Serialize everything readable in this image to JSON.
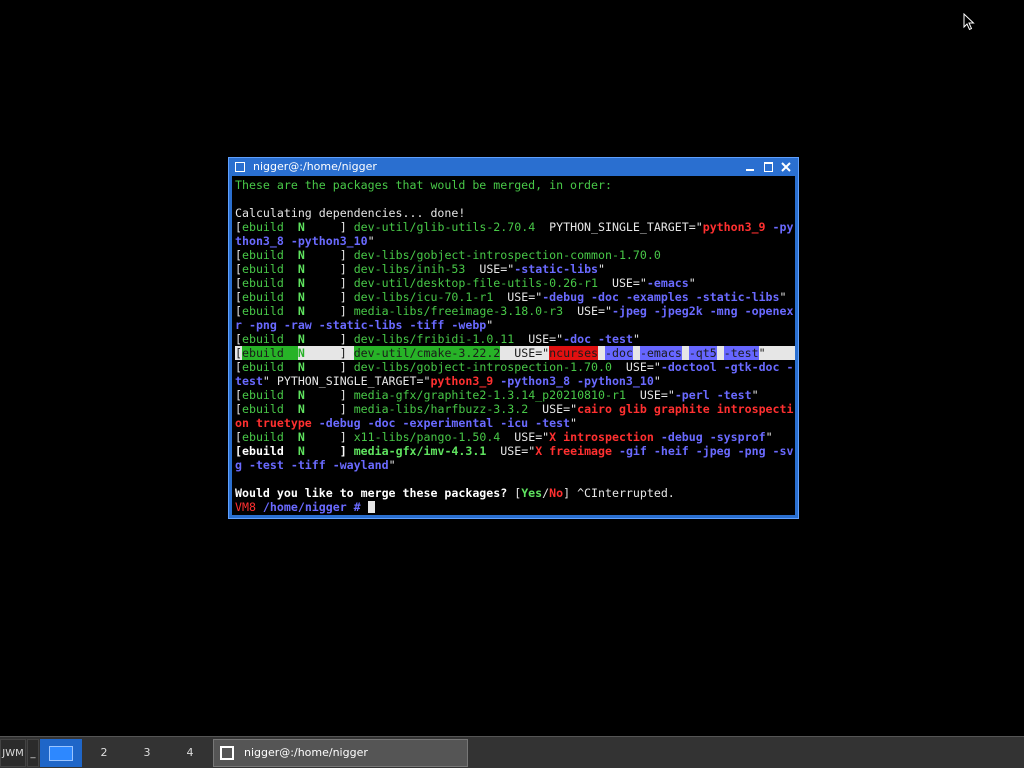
{
  "window": {
    "title": "nigger@:/home/nigger"
  },
  "terminal": {
    "l01": "These are the packages that would be merged, in order:",
    "l03": "Calculating dependencies... done!",
    "eb_open": "[",
    "eb_word": "ebuild",
    "eb_flag": "N",
    "eb_close": "]",
    "l04_pkg": "dev-util/glib-utils-2.70.4",
    "l04_mid": "  PYTHON_SINGLE_TARGET=\"",
    "l04_v1": "python3_9",
    "l04_v2": " -py",
    "l05_a": "thon3_8 -python3_10",
    "l05_q": "\"",
    "l06_pkg": "dev-libs/gobject-introspection-common-1.70.0",
    "l07_pkg": "dev-libs/inih-53",
    "use_open": "  USE=\"",
    "quote": "\"",
    "l07_u": "-static-libs",
    "l08_pkg": "dev-util/desktop-file-utils-0.26-r1",
    "l08_u": "-emacs",
    "l09_pkg": "dev-libs/icu-70.1-r1",
    "l09_u": "-debug -doc -examples -static-libs",
    "l10_pkg": "media-libs/freeimage-3.18.0-r3",
    "l10_u": "-jpeg -jpeg2k -mng -openex",
    "l11_u": "r -png -raw -static-libs -tiff -webp",
    "l12_pkg": "dev-libs/fribidi-1.0.11",
    "l12_u": "-doc -test",
    "l13_pkg": "dev-util/cmake-3.22.2",
    "l13_u1": "ncurses",
    "l13_u2": "-doc",
    "l13_u3": "-emacs",
    "l13_u4": "-qt5",
    "l13_u5": "-test",
    "l14_pkg": "dev-libs/gobject-introspection-1.70.0",
    "l14_u": "-doctool -gtk-doc -",
    "l15_a": "test",
    "l15_b": "\" PYTHON_SINGLE_TARGET=\"",
    "l15_c": "python3_9",
    "l15_d": " -python3_8 -python3_10",
    "l16_pkg": "media-gfx/graphite2-1.3.14_p20210810-r1",
    "l16_u": "-perl -test",
    "l17_pkg": "media-libs/harfbuzz-3.3.2",
    "l17_u": "cairo glib graphite introspecti",
    "l18_a": "on truetype",
    "l18_b": " -debug -doc -experimental -icu -test",
    "l19_pkg": "x11-libs/pango-1.50.4",
    "l19_u1": "X introspection",
    "l19_u2": " -debug -sysprof",
    "l20_pkg": "media-gfx/imv-4.3.1",
    "l20_u1": "X freeimage",
    "l20_u2": " -gif -heif -jpeg -png -sv",
    "l21_a": "g -test -tiff -wayland",
    "l23_q": "Would you like to merge these packages?",
    "l23_b1": " [",
    "l23_yes": "Yes",
    "l23_slash": "/",
    "l23_no": "No",
    "l23_b2": "] ^CInterrupted.",
    "prompt_host": "VM8",
    "prompt_path": " /home/nigger #",
    "prompt_space": " "
  },
  "taskbar": {
    "menu_label": "JWM",
    "show_desktop": "_",
    "desktops": [
      "2",
      "3",
      "4"
    ],
    "task_label": "nigger@:/home/nigger"
  }
}
